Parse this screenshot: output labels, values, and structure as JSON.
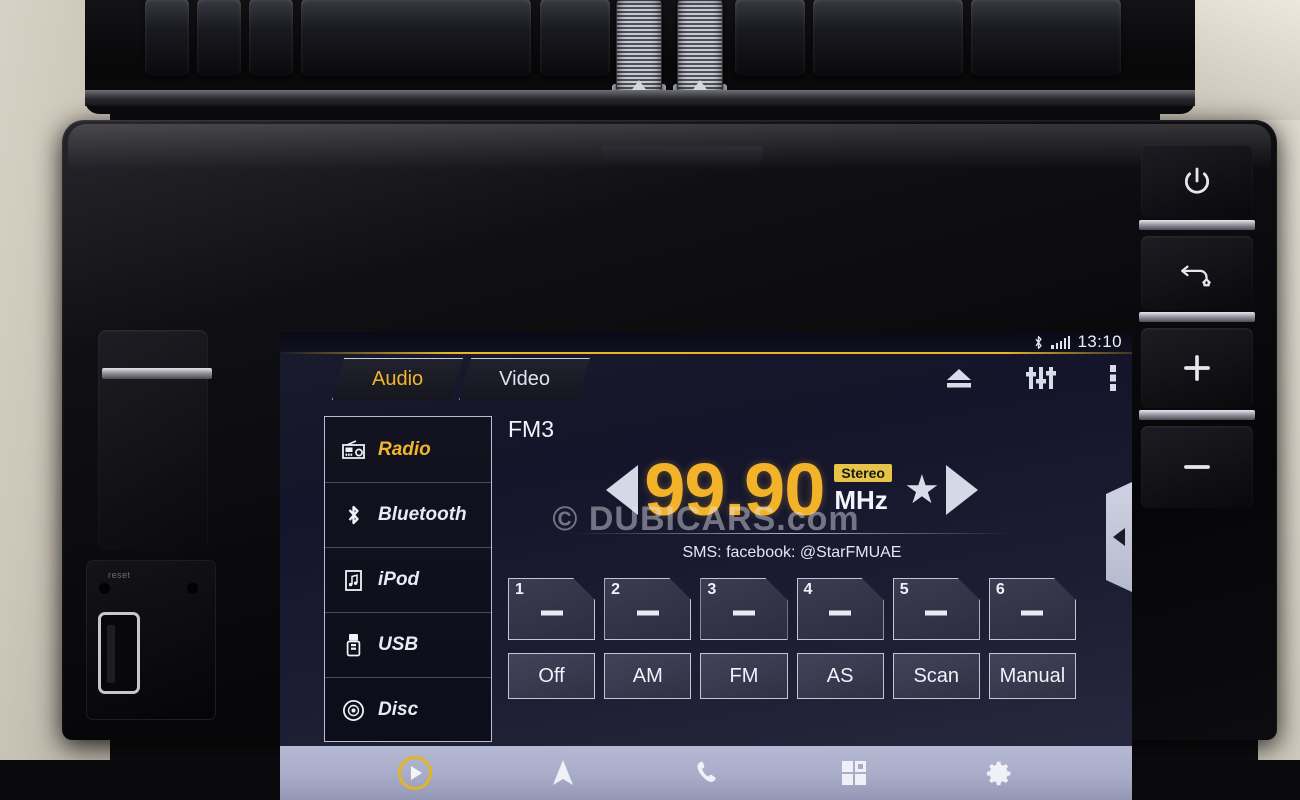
{
  "status_bar": {
    "bluetooth_icon": "bluetooth-icon",
    "signal_icon": "signal-bars-icon",
    "signal_bars": 5,
    "time": "13:10"
  },
  "header_icons": [
    {
      "name": "eject-icon",
      "glyph": "eject"
    },
    {
      "name": "equalizer-icon",
      "glyph": "sliders"
    },
    {
      "name": "overflow-menu-icon",
      "glyph": "dots-vertical"
    }
  ],
  "tabs": [
    {
      "label": "Audio",
      "active": true
    },
    {
      "label": "Video",
      "active": false
    }
  ],
  "sidebar": {
    "items": [
      {
        "label": "Radio",
        "icon": "radio-icon",
        "active": true
      },
      {
        "label": "Bluetooth",
        "icon": "bluetooth-icon",
        "active": false
      },
      {
        "label": "iPod",
        "icon": "ipod-icon",
        "active": false
      },
      {
        "label": "USB",
        "icon": "usb-icon",
        "active": false
      },
      {
        "label": "Disc",
        "icon": "disc-icon",
        "active": false
      }
    ]
  },
  "radio": {
    "band": "FM3",
    "frequency": "99.90",
    "unit": "MHz",
    "stereo_badge": "Stereo",
    "favorite_icon": "star-icon",
    "tune_down_icon": "triangle-left-icon",
    "tune_up_icon": "triangle-right-icon",
    "sms_line": "SMS: facebook: @StarFMUAE",
    "presets": [
      {
        "number": "1",
        "value": "—"
      },
      {
        "number": "2",
        "value": "—"
      },
      {
        "number": "3",
        "value": "—"
      },
      {
        "number": "4",
        "value": "—"
      },
      {
        "number": "5",
        "value": "—"
      },
      {
        "number": "6",
        "value": "—"
      }
    ],
    "modes": [
      {
        "label": "Off"
      },
      {
        "label": "AM"
      },
      {
        "label": "FM"
      },
      {
        "label": "AS"
      },
      {
        "label": "Scan"
      },
      {
        "label": "Manual"
      }
    ]
  },
  "side_tab": {
    "icon": "chevron-left-icon"
  },
  "bottom_nav": [
    {
      "name": "media-play-button",
      "icon": "play-circle-icon",
      "active": true
    },
    {
      "name": "navigation-button",
      "icon": "navigation-arrow-icon",
      "active": false
    },
    {
      "name": "phone-button",
      "icon": "phone-handset-icon",
      "active": false
    },
    {
      "name": "apps-button",
      "icon": "apps-grid-icon",
      "active": false
    },
    {
      "name": "settings-button",
      "icon": "gear-icon",
      "active": false
    }
  ],
  "hardware": {
    "power_button": {
      "icon": "power-icon"
    },
    "back_home_button": {
      "icon": "back-home-icon"
    },
    "volume_up_button": {
      "icon": "plus-icon"
    },
    "volume_down_button": {
      "icon": "minus-icon"
    },
    "reset_label": "reset",
    "port": {
      "name": "hdmi-port"
    }
  },
  "watermark": {
    "text": "© DUBICARS.com"
  },
  "colors": {
    "accent_yellow": "#f2b32b",
    "stereo_badge_bg": "#e8c34a",
    "screen_text": "#f2f4fa",
    "panel_border": "#c2c6d4",
    "nav_bar_bg": "#a9acc8"
  }
}
